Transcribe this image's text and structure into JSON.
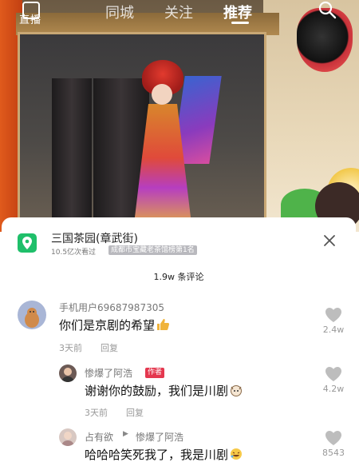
{
  "nav": {
    "live_label": "直播",
    "tabs": [
      {
        "label": "同城"
      },
      {
        "label": "关注"
      },
      {
        "label": "推荐"
      }
    ]
  },
  "icons": {
    "search": "search-icon",
    "close": "close-icon",
    "location": "location-pin-icon",
    "heart": "heart-icon"
  },
  "colors": {
    "accent_green": "#1fbf6a",
    "author_tag": "#e4384f",
    "muted_text": "#999999"
  },
  "place": {
    "name": "三国茶园(章武街)",
    "views": "10.5亿次看过",
    "rank": "成都市宝藏老茶馆榜第1名"
  },
  "comments_header": "1.9w 条评论",
  "comments": [
    {
      "user": "手机用户69687987305",
      "text": "你们是京剧的希望",
      "time": "3天前",
      "reply": "回复",
      "likes": "2.4w"
    }
  ],
  "replies": [
    {
      "user": "惨爆了阿浩",
      "tag": "作者",
      "text": "谢谢你的鼓励，我们是川剧",
      "time": "3天前",
      "reply": "回复",
      "likes": "4.2w"
    },
    {
      "user": "占有欲",
      "arrow": "▶",
      "to_user": "惨爆了阿浩",
      "text": "哈哈哈笑死我了，我是川剧",
      "likes": "8543"
    }
  ]
}
